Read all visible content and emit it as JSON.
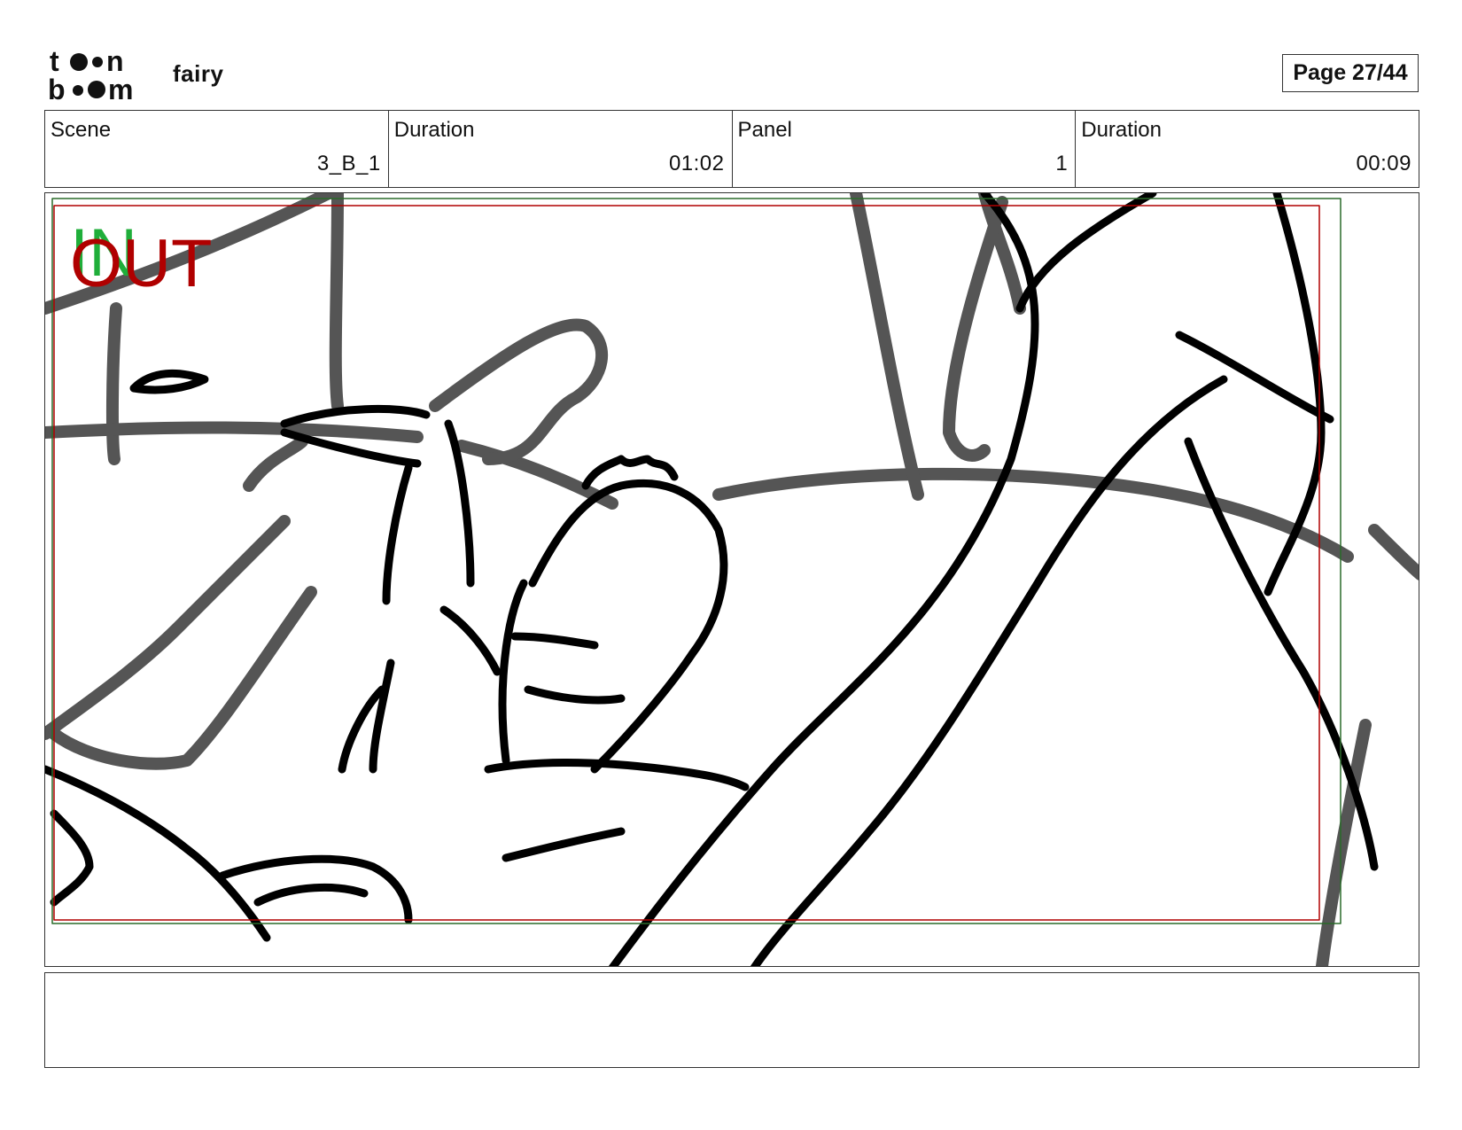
{
  "header": {
    "logo_text_top": "toon",
    "logo_text_bottom": "boom",
    "project_title": "fairy",
    "page_label": "Page 27/44"
  },
  "info": {
    "scene_label": "Scene",
    "scene_value": "3_B_1",
    "scene_duration_label": "Duration",
    "scene_duration_value": "01:02",
    "panel_label": "Panel",
    "panel_value": "1",
    "panel_duration_label": "Duration",
    "panel_duration_value": "00:09"
  },
  "panel": {
    "in_marker": "IN",
    "out_marker": "OUT",
    "in_color": "#1fae3a",
    "out_color": "#b00000"
  },
  "notes": {
    "text": ""
  }
}
